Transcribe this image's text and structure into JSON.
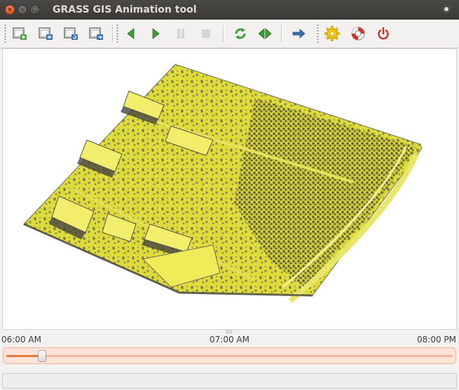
{
  "window": {
    "title": "GRASS GIS Animation tool"
  },
  "toolbar": {
    "buttons": [
      {
        "name": "add-animation-button",
        "icon": "layer-add-icon",
        "enabled": true
      },
      {
        "name": "edit-animation-button",
        "icon": "layer-edit-icon",
        "enabled": true
      },
      {
        "name": "reload-button",
        "icon": "layer-reload-icon",
        "enabled": true
      },
      {
        "name": "export-button",
        "icon": "layer-export-icon",
        "enabled": true
      },
      {
        "name": "play-back-button",
        "icon": "play-back-icon",
        "enabled": true
      },
      {
        "name": "play-button",
        "icon": "play-icon",
        "enabled": true
      },
      {
        "name": "pause-button",
        "icon": "pause-icon",
        "enabled": false
      },
      {
        "name": "stop-button",
        "icon": "stop-icon",
        "enabled": false
      },
      {
        "name": "loop-button",
        "icon": "loop-icon",
        "enabled": true
      },
      {
        "name": "bounce-button",
        "icon": "bounce-icon",
        "enabled": true
      },
      {
        "name": "speed-button",
        "icon": "arrow-right-icon",
        "enabled": true
      },
      {
        "name": "settings-button",
        "icon": "gear-icon",
        "enabled": true
      },
      {
        "name": "help-button",
        "icon": "help-lifebuoy-icon",
        "enabled": true
      },
      {
        "name": "quit-button",
        "icon": "power-icon",
        "enabled": true
      }
    ]
  },
  "timeline": {
    "start_label": "06:00 AM",
    "current_label": "07:00 AM",
    "end_label": "08:00 PM",
    "slider_position": 0.08
  },
  "status": {
    "text": ""
  },
  "colors": {
    "accent": "#e6783f",
    "terrain": "#dedc3a",
    "terrain_shadow": "#5a5a52"
  }
}
